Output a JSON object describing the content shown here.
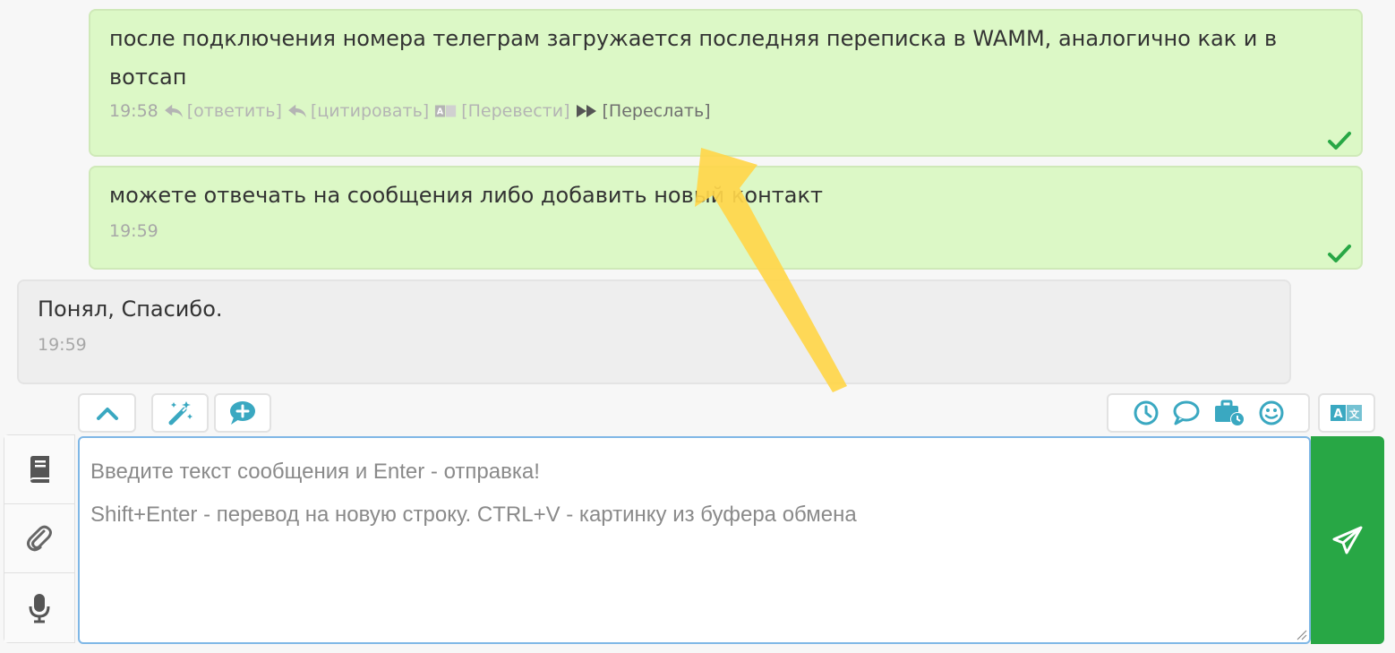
{
  "messages": [
    {
      "direction": "out",
      "text": "после подключения номера телеграм загружается последняя переписка в WAMM, аналогично как и в вотсап",
      "time": "19:58",
      "actions": {
        "reply": "[ответить]",
        "quote": "[цитировать]",
        "translate": "[Перевести]",
        "forward": "[Переслать]"
      }
    },
    {
      "direction": "out",
      "text": "можете отвечать на сообщения либо добавить новый контакт",
      "time": "19:59"
    },
    {
      "direction": "in",
      "text": "Понял, Спасибо.",
      "time": "19:59"
    }
  ],
  "composer": {
    "placeholder": "Введите текст сообщения и Enter - отправка!\nShift+Enter - перевод на новую строку. CTRL+V - картинку из буфера обмена",
    "placeholder_line1": "Введите текст сообщения и Enter - отправка!",
    "placeholder_line2": "Shift+Enter - перевод на новую строку. CTRL+V - картинку из буфера обмена"
  },
  "icons": {
    "toolbar_left": [
      "chevron-up-icon",
      "magic-wand-icon",
      "comment-plus-icon"
    ],
    "toolbar_right": [
      "clock-icon",
      "comment-icon",
      "briefcase-clock-icon",
      "smile-icon"
    ],
    "translate": "translate-icon",
    "side": [
      "book-icon",
      "paperclip-icon",
      "microphone-icon"
    ],
    "send": "paper-plane-icon"
  },
  "colors": {
    "outgoing_bubble": "#dcf8c6",
    "incoming_bubble": "#eeeeee",
    "accent": "#3aa8c1",
    "send_button": "#28a745",
    "check": "#28a745",
    "annotation_arrow": "#ffd64a"
  }
}
